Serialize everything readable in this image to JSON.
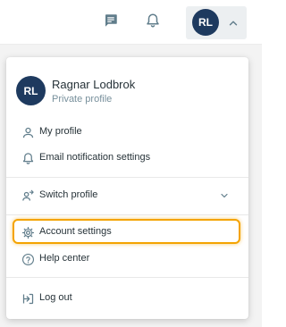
{
  "topbar": {
    "icons": [
      "chat-icon",
      "bell-icon"
    ],
    "user_initials": "RL"
  },
  "menu": {
    "profile": {
      "initials": "RL",
      "name": "Ragnar Lodbrok",
      "subtitle": "Private profile"
    },
    "items": {
      "my_profile": "My profile",
      "email_notifications": "Email notification settings",
      "switch_profile": "Switch profile",
      "account_settings": "Account settings",
      "help_center": "Help center",
      "log_out": "Log out"
    },
    "highlighted_item": "account_settings",
    "highlight_color": "#f4a300"
  },
  "colors": {
    "avatar_bg": "#1e3a5f",
    "chip_bg": "#eceff1"
  }
}
